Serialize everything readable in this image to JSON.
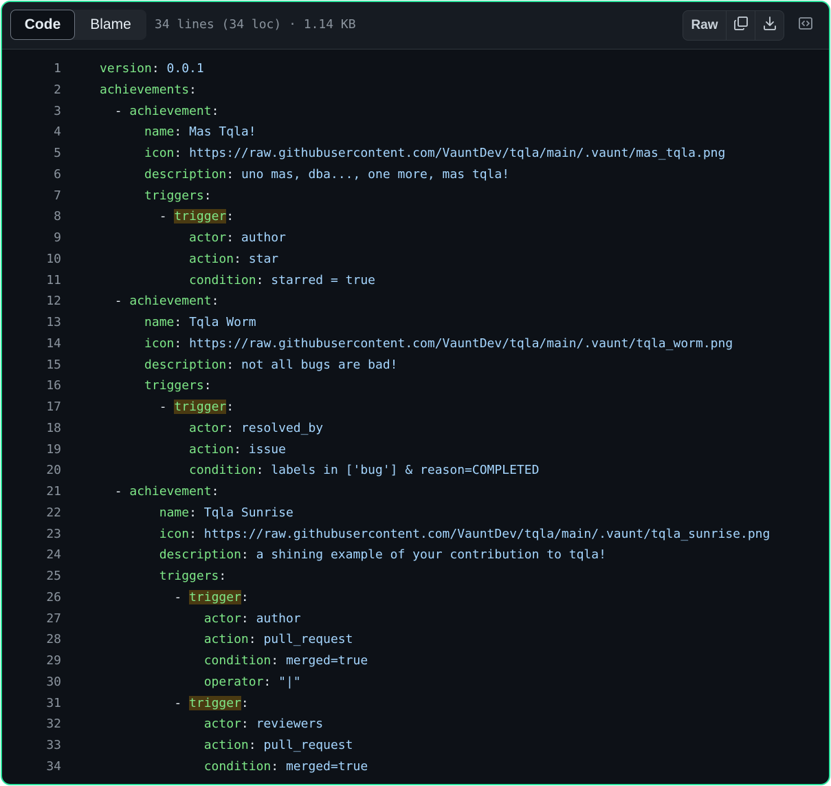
{
  "toolbar": {
    "tabs": [
      {
        "label": "Code",
        "active": true
      },
      {
        "label": "Blame",
        "active": false
      }
    ],
    "file_info": "34 lines (34 loc) · 1.14 KB",
    "raw_label": "Raw",
    "icons": {
      "copy": "copy-icon",
      "download": "download-icon",
      "symbols": "code-symbols-icon"
    }
  },
  "colors": {
    "accent_border": "#2ee6a0",
    "background": "#0d1117",
    "key": "#7ee787",
    "value": "#a5d6ff",
    "highlight": "#4a3a12"
  },
  "code_lines": [
    {
      "n": "1",
      "indent": "",
      "dash": "",
      "key": "version",
      "value": "0.0.1",
      "hl": false
    },
    {
      "n": "2",
      "indent": "",
      "dash": "",
      "key": "achievements",
      "value": "",
      "hl": false
    },
    {
      "n": "3",
      "indent": "  ",
      "dash": "- ",
      "key": "achievement",
      "value": "",
      "hl": false
    },
    {
      "n": "4",
      "indent": "      ",
      "dash": "",
      "key": "name",
      "value": "Mas Tqla!",
      "hl": false
    },
    {
      "n": "5",
      "indent": "      ",
      "dash": "",
      "key": "icon",
      "value": "https://raw.githubusercontent.com/VauntDev/tqla/main/.vaunt/mas_tqla.png",
      "hl": false
    },
    {
      "n": "6",
      "indent": "      ",
      "dash": "",
      "key": "description",
      "value": "uno mas, dba..., one more, mas tqla!",
      "hl": false
    },
    {
      "n": "7",
      "indent": "      ",
      "dash": "",
      "key": "triggers",
      "value": "",
      "hl": false
    },
    {
      "n": "8",
      "indent": "        ",
      "dash": "- ",
      "key": "trigger",
      "value": "",
      "hl": true
    },
    {
      "n": "9",
      "indent": "            ",
      "dash": "",
      "key": "actor",
      "value": "author",
      "hl": false
    },
    {
      "n": "10",
      "indent": "            ",
      "dash": "",
      "key": "action",
      "value": "star",
      "hl": false
    },
    {
      "n": "11",
      "indent": "            ",
      "dash": "",
      "key": "condition",
      "value": "starred = true",
      "hl": false
    },
    {
      "n": "12",
      "indent": "  ",
      "dash": "- ",
      "key": "achievement",
      "value": "",
      "hl": false
    },
    {
      "n": "13",
      "indent": "      ",
      "dash": "",
      "key": "name",
      "value": "Tqla Worm",
      "hl": false
    },
    {
      "n": "14",
      "indent": "      ",
      "dash": "",
      "key": "icon",
      "value": "https://raw.githubusercontent.com/VauntDev/tqla/main/.vaunt/tqla_worm.png",
      "hl": false
    },
    {
      "n": "15",
      "indent": "      ",
      "dash": "",
      "key": "description",
      "value": "not all bugs are bad!",
      "hl": false
    },
    {
      "n": "16",
      "indent": "      ",
      "dash": "",
      "key": "triggers",
      "value": "",
      "hl": false
    },
    {
      "n": "17",
      "indent": "        ",
      "dash": "- ",
      "key": "trigger",
      "value": "",
      "hl": true
    },
    {
      "n": "18",
      "indent": "            ",
      "dash": "",
      "key": "actor",
      "value": "resolved_by",
      "hl": false
    },
    {
      "n": "19",
      "indent": "            ",
      "dash": "",
      "key": "action",
      "value": "issue",
      "hl": false
    },
    {
      "n": "20",
      "indent": "            ",
      "dash": "",
      "key": "condition",
      "value": "labels in ['bug'] & reason=COMPLETED",
      "hl": false
    },
    {
      "n": "21",
      "indent": "  ",
      "dash": "- ",
      "key": "achievement",
      "value": "",
      "hl": false
    },
    {
      "n": "22",
      "indent": "        ",
      "dash": "",
      "key": "name",
      "value": "Tqla Sunrise",
      "hl": false
    },
    {
      "n": "23",
      "indent": "        ",
      "dash": "",
      "key": "icon",
      "value": "https://raw.githubusercontent.com/VauntDev/tqla/main/.vaunt/tqla_sunrise.png",
      "hl": false
    },
    {
      "n": "24",
      "indent": "        ",
      "dash": "",
      "key": "description",
      "value": "a shining example of your contribution to tqla!",
      "hl": false
    },
    {
      "n": "25",
      "indent": "        ",
      "dash": "",
      "key": "triggers",
      "value": "",
      "hl": false
    },
    {
      "n": "26",
      "indent": "          ",
      "dash": "- ",
      "key": "trigger",
      "value": "",
      "hl": true
    },
    {
      "n": "27",
      "indent": "              ",
      "dash": "",
      "key": "actor",
      "value": "author",
      "hl": false
    },
    {
      "n": "28",
      "indent": "              ",
      "dash": "",
      "key": "action",
      "value": "pull_request",
      "hl": false
    },
    {
      "n": "29",
      "indent": "              ",
      "dash": "",
      "key": "condition",
      "value": "merged=true",
      "hl": false
    },
    {
      "n": "30",
      "indent": "              ",
      "dash": "",
      "key": "operator",
      "value": "\"|\"",
      "hl": false
    },
    {
      "n": "31",
      "indent": "          ",
      "dash": "- ",
      "key": "trigger",
      "value": "",
      "hl": true
    },
    {
      "n": "32",
      "indent": "              ",
      "dash": "",
      "key": "actor",
      "value": "reviewers",
      "hl": false
    },
    {
      "n": "33",
      "indent": "              ",
      "dash": "",
      "key": "action",
      "value": "pull_request",
      "hl": false
    },
    {
      "n": "34",
      "indent": "              ",
      "dash": "",
      "key": "condition",
      "value": "merged=true",
      "hl": false
    }
  ]
}
